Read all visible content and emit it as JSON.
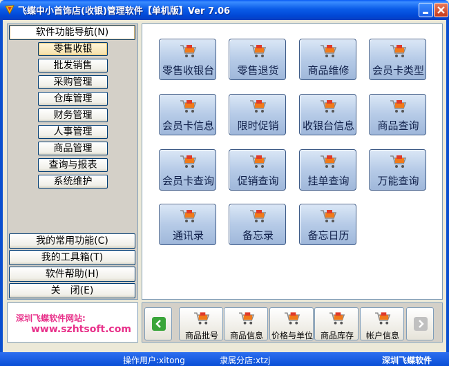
{
  "window": {
    "title": "飞蝶中小首饰店(收银)管理软件【单机版】Ver 7.06"
  },
  "nav": {
    "header": "软件功能导航(N)",
    "items": [
      "零售收银",
      "批发销售",
      "采购管理",
      "仓库管理",
      "财务管理",
      "人事管理",
      "商品管理",
      "查询与报表",
      "系统维护"
    ],
    "active_item": "零售收银"
  },
  "bottom_menu": [
    "我的常用功能(C)",
    "我的工具箱(T)",
    "软件帮助(H)",
    "关　闭(E)"
  ],
  "site": {
    "label": "深圳飞蝶软件网站:",
    "url": "www.szhtsoft.com"
  },
  "functions": [
    "零售收银台",
    "零售退货",
    "商品维修",
    "会员卡类型",
    "会员卡信息",
    "限时促销",
    "收银台信息",
    "商品查询",
    "会员卡查询",
    "促销查询",
    "挂单查询",
    "万能查询",
    "通讯录",
    "备忘录",
    "备忘日历"
  ],
  "quick_bar": [
    "商品批号",
    "商品信息",
    "价格与单位",
    "商品库存",
    "帐户信息"
  ],
  "status": {
    "user": "操作用户:xitong",
    "branch": "隶属分店:xtzj",
    "company": "深圳飞蝶软件"
  },
  "colors": {
    "title_blue": "#0a5bf4",
    "accent_pink": "#e8318a",
    "cart_orange": "#f07a1a",
    "cart_red": "#e03a2a"
  },
  "icons": {
    "function": "shopping-cart-icon",
    "prev": "arrow-left-icon",
    "next": "arrow-right-icon"
  }
}
